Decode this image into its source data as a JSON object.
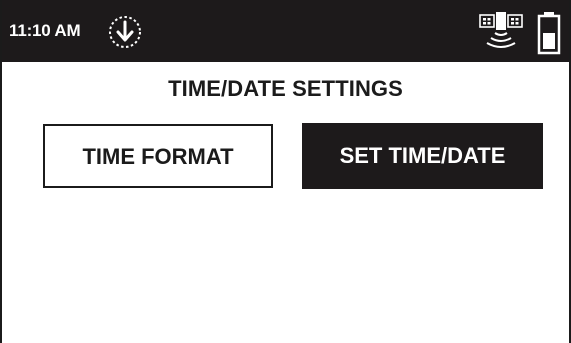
{
  "status_bar": {
    "time": "11:10 AM",
    "icons": {
      "download": "download-arrow-icon",
      "satellite": "satellite-signal-icon",
      "battery": "battery-icon"
    },
    "colors": {
      "background": "#1d1a1b",
      "foreground": "#ffffff"
    }
  },
  "main": {
    "title": "TIME/DATE SETTINGS",
    "buttons": [
      {
        "label": "TIME FORMAT",
        "style": "outlined"
      },
      {
        "label": "SET TIME/DATE",
        "style": "filled"
      }
    ]
  }
}
